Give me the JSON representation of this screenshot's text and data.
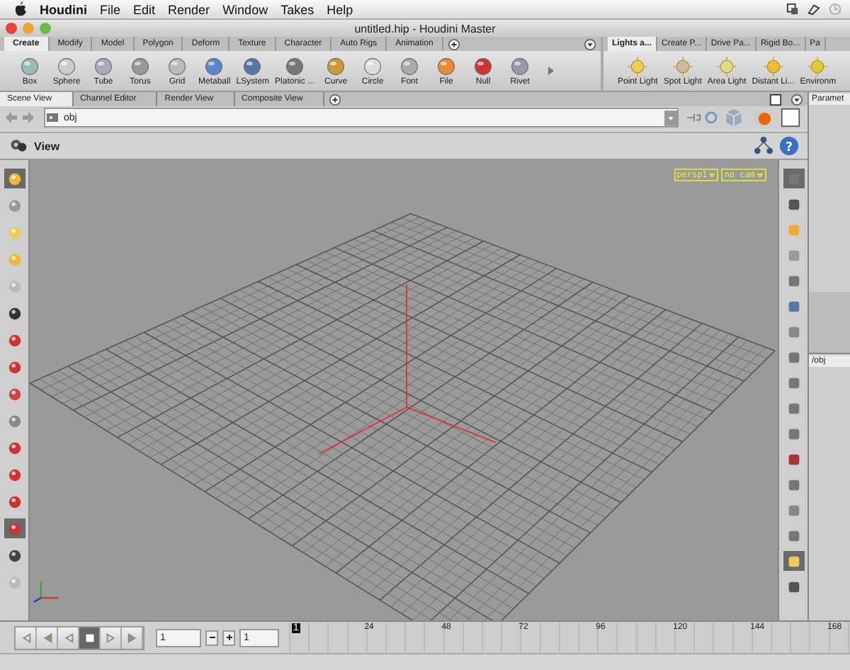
{
  "menu_bar": {
    "app": "Houdini",
    "items": [
      "File",
      "Edit",
      "Render",
      "Window",
      "Takes",
      "Help"
    ]
  },
  "window": {
    "title": "untitled.hip - Houdini Master"
  },
  "shelf_left": {
    "tabs": [
      {
        "label": "Create",
        "selected": true
      },
      {
        "label": "Modify",
        "selected": false
      },
      {
        "label": "Model",
        "selected": false
      },
      {
        "label": "Polygon",
        "selected": false
      },
      {
        "label": "Deform",
        "selected": false
      },
      {
        "label": "Texture",
        "selected": false
      },
      {
        "label": "Character",
        "selected": false
      },
      {
        "label": "Auto Rigs",
        "selected": false
      },
      {
        "label": "Animation",
        "selected": false
      }
    ],
    "tools": [
      "Box",
      "Sphere",
      "Tube",
      "Torus",
      "Grid",
      "Metaball",
      "LSystem",
      "Platonic ...",
      "Curve",
      "Circle",
      "Font",
      "File",
      "Null",
      "Rivet"
    ]
  },
  "shelf_right": {
    "tabs": [
      {
        "label": "Lights a...",
        "selected": true
      },
      {
        "label": "Create P...",
        "selected": false
      },
      {
        "label": "Drive Pa...",
        "selected": false
      },
      {
        "label": "Rigid Bo...",
        "selected": false
      },
      {
        "label": "Pa",
        "selected": false
      }
    ],
    "tools": [
      "Point Light",
      "Spot Light",
      "Area Light",
      "Distant Li...",
      "Environm"
    ]
  },
  "pane_tabs": [
    {
      "label": "Scene View",
      "selected": true
    },
    {
      "label": "Channel Editor",
      "selected": false
    },
    {
      "label": "Render View",
      "selected": false
    },
    {
      "label": "Composite View",
      "selected": false
    }
  ],
  "path": {
    "value": "obj"
  },
  "help": {
    "glyph": "?"
  },
  "view": {
    "title": "View",
    "camera_menus": [
      "persp1",
      "no cam"
    ]
  },
  "left_tools": [
    {
      "selected": true
    },
    {
      "selected": false
    },
    {
      "selected": false
    },
    {
      "selected": false
    },
    {
      "selected": false
    },
    {
      "selected": false
    },
    {
      "selected": false
    },
    {
      "selected": false
    },
    {
      "selected": false
    },
    {
      "selected": false
    },
    {
      "selected": false
    },
    {
      "selected": false
    },
    {
      "selected": false
    },
    {
      "selected": true
    },
    {
      "selected": false
    },
    {
      "selected": false
    }
  ],
  "right_tools": [
    {
      "selected": true
    },
    {
      "selected": false
    },
    {
      "selected": false
    },
    {
      "selected": false
    },
    {
      "selected": false
    },
    {
      "selected": false
    },
    {
      "selected": false
    },
    {
      "selected": false
    },
    {
      "selected": false
    },
    {
      "selected": false
    },
    {
      "selected": false
    },
    {
      "selected": false
    },
    {
      "selected": false
    },
    {
      "selected": false
    },
    {
      "selected": false
    },
    {
      "selected": true
    },
    {
      "selected": false
    }
  ],
  "side_panel": {
    "tab": "Paramet",
    "network_tab": "/obj"
  },
  "timeline": {
    "start_field": "1",
    "frame_field": "1",
    "ticks": [
      {
        "label": "1",
        "selected": true
      },
      {
        "label": "24",
        "selected": false
      },
      {
        "label": "48",
        "selected": false
      },
      {
        "label": "72",
        "selected": false
      },
      {
        "label": "96",
        "selected": false
      },
      {
        "label": "120",
        "selected": false
      },
      {
        "label": "144",
        "selected": false
      },
      {
        "label": "168",
        "selected": false
      }
    ]
  }
}
